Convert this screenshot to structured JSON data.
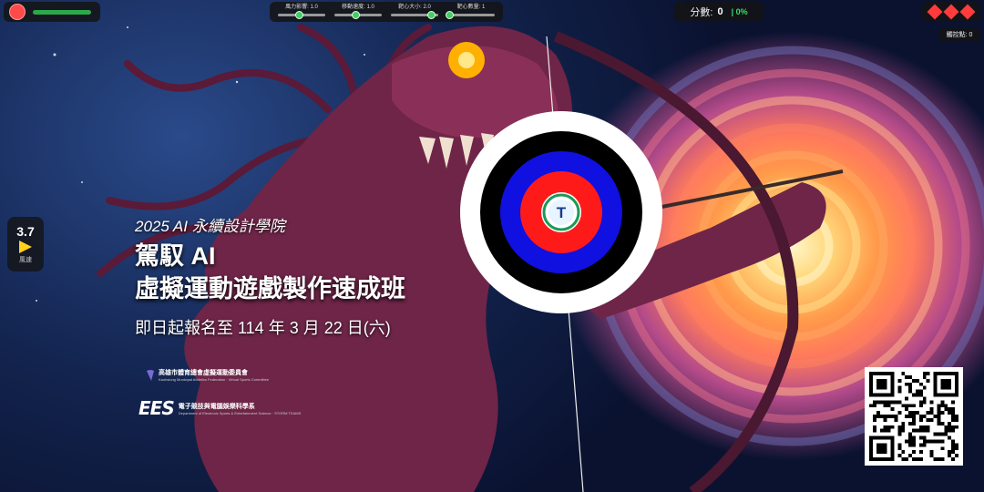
{
  "hud": {
    "record_color": "#ff4a4a",
    "health_color": "#2aa84a",
    "sliders": [
      {
        "label": "風力影響: 1.0",
        "value": 0.45
      },
      {
        "label": "移動速度: 1.0",
        "value": 0.45
      },
      {
        "label": "靶心大小: 2.0",
        "value": 0.85
      },
      {
        "label": "靶心數量: 1",
        "value": 0.05
      }
    ],
    "score_label": "分數:",
    "score_value": "0",
    "accuracy": "| 0%",
    "lives": 3,
    "touch_label": "觸控點: 0"
  },
  "wind": {
    "value": "3.7",
    "label": "風速",
    "arrow_color": "#ffd21c"
  },
  "poster": {
    "subtitle": "2025 AI 永續設計學院",
    "title_line1": "駕馭 AI",
    "title_line2": "虛擬運動遊戲製作速成班",
    "date": "即日起報名至 114 年 3 月 22 日(六)",
    "org1_name": "高雄市體育總會虛擬運動委員會",
    "org1_en": "Kaohsiung Municipal Athletics Federation · Virtual Sports Committee",
    "org2_logo": "EES",
    "org2_name": "電子競技與電腦娛樂科學系",
    "org2_en": "Department of Electronic Sports & Entertainment Science · STORM TEAMS"
  },
  "target": {
    "ring_colors": [
      "#ffffff",
      "#000000",
      "#1010e0",
      "#ff1a1a"
    ],
    "emblem_letter": "T",
    "emblem_color": "#1a9a5a"
  }
}
